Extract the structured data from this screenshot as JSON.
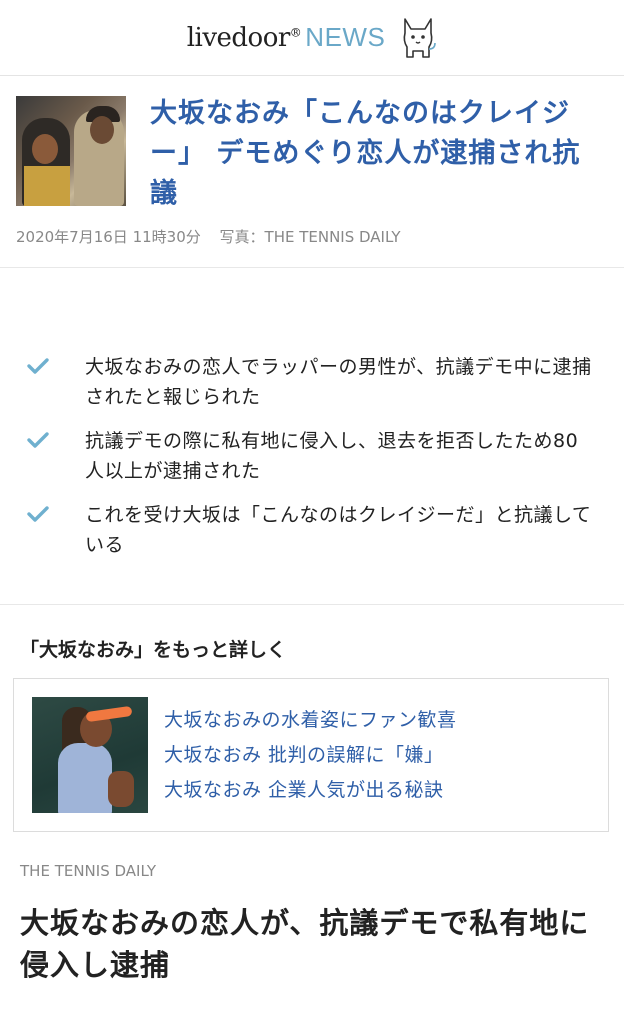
{
  "header": {
    "logo_brand": "livedoor",
    "logo_mark": "®",
    "logo_news": "NEWS",
    "mascot_icon": "dog-mascot-icon"
  },
  "article": {
    "title": "大坂なおみ「こんなのはクレイジー」 デモめぐり恋人が逮捕され抗議",
    "date": "2020年7月16日 11時30分",
    "photo_credit": "写真：THE TENNIS DAILY"
  },
  "summary": {
    "icon": "checkmark-icon",
    "check_color": "#6fb0cf",
    "points": [
      "大坂なおみの恋人でラッパーの男性が、抗議デモ中に逮捕されたと報じられた",
      "抗議デモの際に私有地に侵入し、退去を拒否したため80人以上が逮捕された",
      "これを受け大坂は「こんなのはクレイジーだ」と抗議している"
    ]
  },
  "related": {
    "heading": "「大坂なおみ」をもっと詳しく",
    "links": [
      "大坂なおみの水着姿にファン歓喜",
      "大坂なおみ 批判の誤解に「嫌」",
      "大坂なおみ 企業人気が出る秘訣"
    ]
  },
  "body": {
    "source": "THE TENNIS DAILY",
    "headline": "大坂なおみの恋人が、抗議デモで私有地に侵入し逮捕"
  },
  "colors": {
    "link_blue": "#2f5fa8",
    "news_blue": "#6aa8c8"
  }
}
